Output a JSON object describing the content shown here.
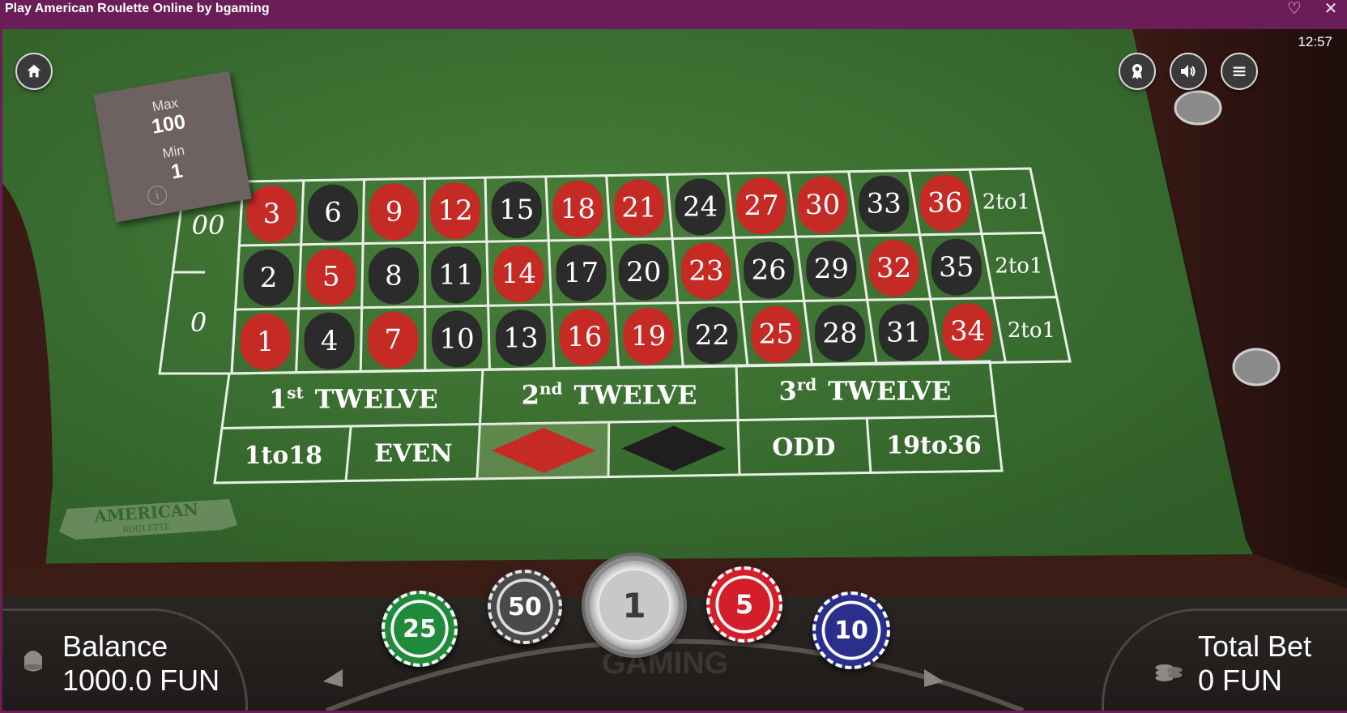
{
  "window": {
    "title": "Play American Roulette Online by bgaming"
  },
  "icons": {
    "favorite": "heart-icon",
    "close": "close-icon",
    "home": "home-icon",
    "award": "award-icon",
    "sound": "sound-icon",
    "menu": "menu-icon",
    "info": "info-icon",
    "coins": "coins-icon"
  },
  "clock": "12:57",
  "limits": {
    "max_label": "Max",
    "max_value": "100",
    "min_label": "Min",
    "min_value": "1",
    "info": "i"
  },
  "table": {
    "zeros": [
      "00",
      "0"
    ],
    "rows": [
      [
        {
          "n": "3",
          "c": "red"
        },
        {
          "n": "6",
          "c": "black"
        },
        {
          "n": "9",
          "c": "red"
        },
        {
          "n": "12",
          "c": "red"
        },
        {
          "n": "15",
          "c": "black"
        },
        {
          "n": "18",
          "c": "red"
        },
        {
          "n": "21",
          "c": "red"
        },
        {
          "n": "24",
          "c": "black"
        },
        {
          "n": "27",
          "c": "red"
        },
        {
          "n": "30",
          "c": "red"
        },
        {
          "n": "33",
          "c": "black"
        },
        {
          "n": "36",
          "c": "red"
        }
      ],
      [
        {
          "n": "2",
          "c": "black"
        },
        {
          "n": "5",
          "c": "red"
        },
        {
          "n": "8",
          "c": "black"
        },
        {
          "n": "11",
          "c": "black"
        },
        {
          "n": "14",
          "c": "red"
        },
        {
          "n": "17",
          "c": "black"
        },
        {
          "n": "20",
          "c": "black"
        },
        {
          "n": "23",
          "c": "red"
        },
        {
          "n": "26",
          "c": "black"
        },
        {
          "n": "29",
          "c": "black"
        },
        {
          "n": "32",
          "c": "red"
        },
        {
          "n": "35",
          "c": "black"
        }
      ],
      [
        {
          "n": "1",
          "c": "red"
        },
        {
          "n": "4",
          "c": "black"
        },
        {
          "n": "7",
          "c": "red"
        },
        {
          "n": "10",
          "c": "black"
        },
        {
          "n": "13",
          "c": "black"
        },
        {
          "n": "16",
          "c": "red"
        },
        {
          "n": "19",
          "c": "red"
        },
        {
          "n": "22",
          "c": "black"
        },
        {
          "n": "25",
          "c": "red"
        },
        {
          "n": "28",
          "c": "black"
        },
        {
          "n": "31",
          "c": "black"
        },
        {
          "n": "34",
          "c": "red"
        }
      ]
    ],
    "column_bets": [
      "2to1",
      "2to1",
      "2to1"
    ],
    "dozens": [
      {
        "num": "1",
        "sup": "st",
        "word": "TWELVE"
      },
      {
        "num": "2",
        "sup": "nd",
        "word": "TWELVE"
      },
      {
        "num": "3",
        "sup": "rd",
        "word": "TWELVE"
      }
    ],
    "outside": {
      "low": "1to18",
      "even": "EVEN",
      "red": "red-diamond",
      "black": "black-diamond",
      "odd": "ODD",
      "high": "19to36"
    },
    "logo": {
      "line1": "AMERICAN",
      "line2": "ROULETTE"
    }
  },
  "colors": {
    "felt": "#3c6e30",
    "red": "#c62a25",
    "black": "#2b2b2b",
    "frame": "#6a1d57",
    "chip_green": "#1f8a3a",
    "chip_gray": "#595959",
    "chip_silver": "#c8c8c8",
    "chip_red": "#d31f2a",
    "chip_blue": "#2a2f8c"
  },
  "balance": {
    "label": "Balance",
    "value": "1000.0 FUN"
  },
  "total_bet": {
    "label": "Total Bet",
    "value": "0 FUN"
  },
  "chips": [
    {
      "value": "25",
      "color": "green"
    },
    {
      "value": "50",
      "color": "gray"
    },
    {
      "value": "1",
      "color": "silver",
      "selected": true
    },
    {
      "value": "5",
      "color": "red"
    },
    {
      "value": "10",
      "color": "blue"
    }
  ],
  "provider_watermark": "GAMING"
}
